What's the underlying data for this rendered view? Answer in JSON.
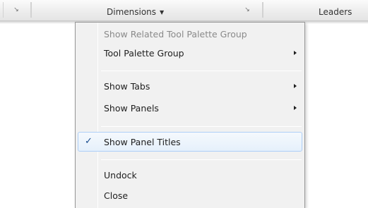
{
  "ribbon": {
    "panels": [
      {
        "title": "Dimensions",
        "has_caret": true
      },
      {
        "title": "Leaders",
        "has_caret": false
      }
    ],
    "launcher_glyph": "↘"
  },
  "menu": {
    "items": [
      {
        "label": "Show Related Tool Palette Group",
        "disabled": true
      },
      {
        "label": "Tool Palette Group",
        "submenu": true
      },
      {
        "label": "Show Tabs",
        "submenu": true
      },
      {
        "label": "Show Panels",
        "submenu": true
      },
      {
        "label": "Show Panel Titles",
        "checked": true
      },
      {
        "label": "Undock"
      },
      {
        "label": "Close"
      }
    ],
    "check_glyph": "✓"
  }
}
